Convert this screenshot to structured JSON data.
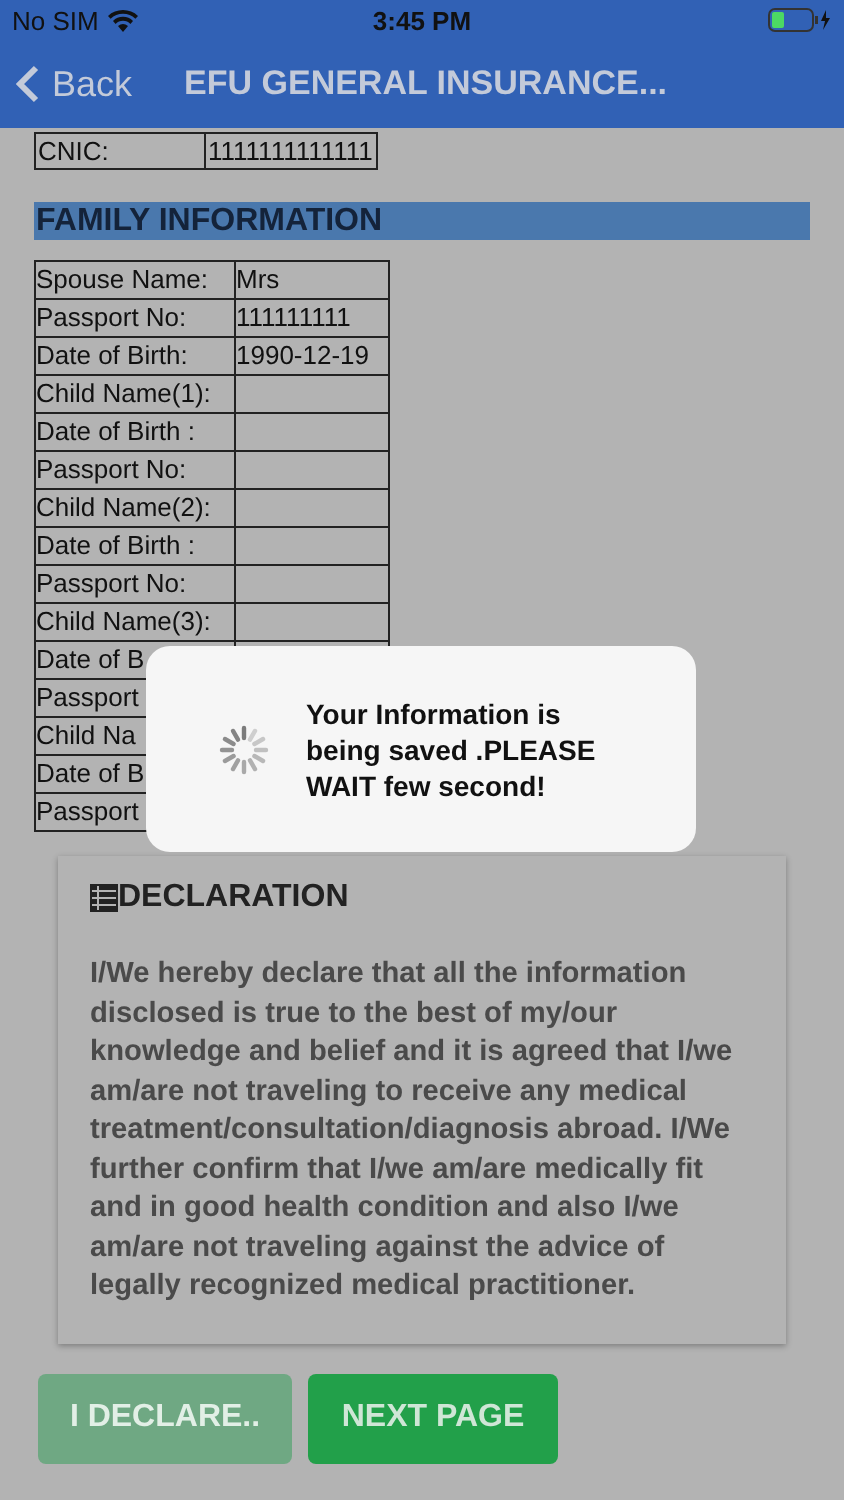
{
  "status_bar": {
    "carrier": "No SIM",
    "time": "3:45 PM"
  },
  "nav": {
    "back": "Back",
    "title": "EFU GENERAL INSURANCE..."
  },
  "cnic": {
    "label": "CNIC:",
    "value": "1111111111111"
  },
  "family": {
    "title": "FAMILY INFORMATION",
    "rows": [
      {
        "label": "Spouse Name:",
        "value": "Mrs"
      },
      {
        "label": "Passport No:",
        "value": "111111111"
      },
      {
        "label": "Date of Birth:",
        "value": "1990-12-19"
      },
      {
        "label": "Child Name(1):"
      },
      {
        "label": "Date of Birth :"
      },
      {
        "label": "Passport No:"
      },
      {
        "label": "Child Name(2):"
      },
      {
        "label": "Date of Birth :"
      },
      {
        "label": "Passport No:"
      },
      {
        "label": "Child Name(3):"
      }
    ],
    "covered_rows": [
      {
        "label": "Date of B"
      },
      {
        "label": "Passport"
      },
      {
        "label": "Child Na"
      },
      {
        "label": "Date of B"
      },
      {
        "label": "Passport"
      }
    ]
  },
  "dialog": {
    "message": "Your Information is being saved .PLEASE WAIT few second!"
  },
  "declaration": {
    "title": "DECLARATION",
    "text": "I/We hereby declare that all the information disclosed is true to the best of my/our knowledge and belief and it is agreed that I/we am/are not traveling to receive any medical treatment/consultation/diagnosis abroad. I/We further confirm that I/we am/are medically fit and in good health condition and also I/we am/are not traveling against the advice of legally recognized medical practitioner."
  },
  "buttons": [
    {
      "label": "I DECLARE..",
      "disabled": true
    },
    {
      "label": "NEXT PAGE",
      "disabled": false
    }
  ]
}
